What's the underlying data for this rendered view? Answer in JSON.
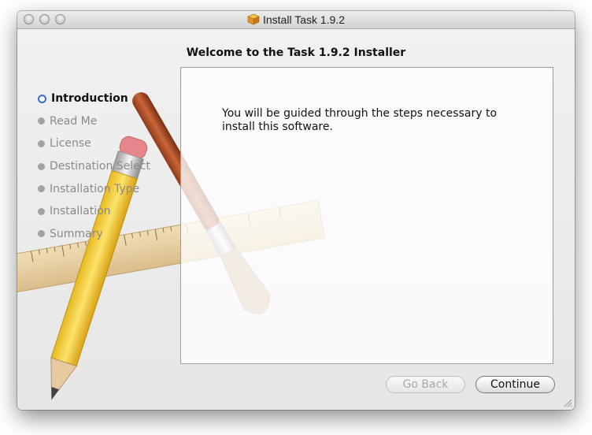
{
  "window": {
    "title": "Install Task 1.9.2",
    "title_icon": "package-icon"
  },
  "header": {
    "heading": "Welcome to the Task 1.9.2 Installer"
  },
  "sidebar": {
    "steps": [
      {
        "label": "Introduction",
        "active": true
      },
      {
        "label": "Read Me",
        "active": false
      },
      {
        "label": "License",
        "active": false
      },
      {
        "label": "Destination Select",
        "active": false
      },
      {
        "label": "Installation Type",
        "active": false
      },
      {
        "label": "Installation",
        "active": false
      },
      {
        "label": "Summary",
        "active": false
      }
    ]
  },
  "main": {
    "body_text": "You will be guided through the steps necessary to install this software."
  },
  "buttons": {
    "back_label": "Go Back",
    "continue_label": "Continue"
  },
  "colors": {
    "accent": "#3b6fce",
    "window_bg": "#e8e8e8"
  }
}
